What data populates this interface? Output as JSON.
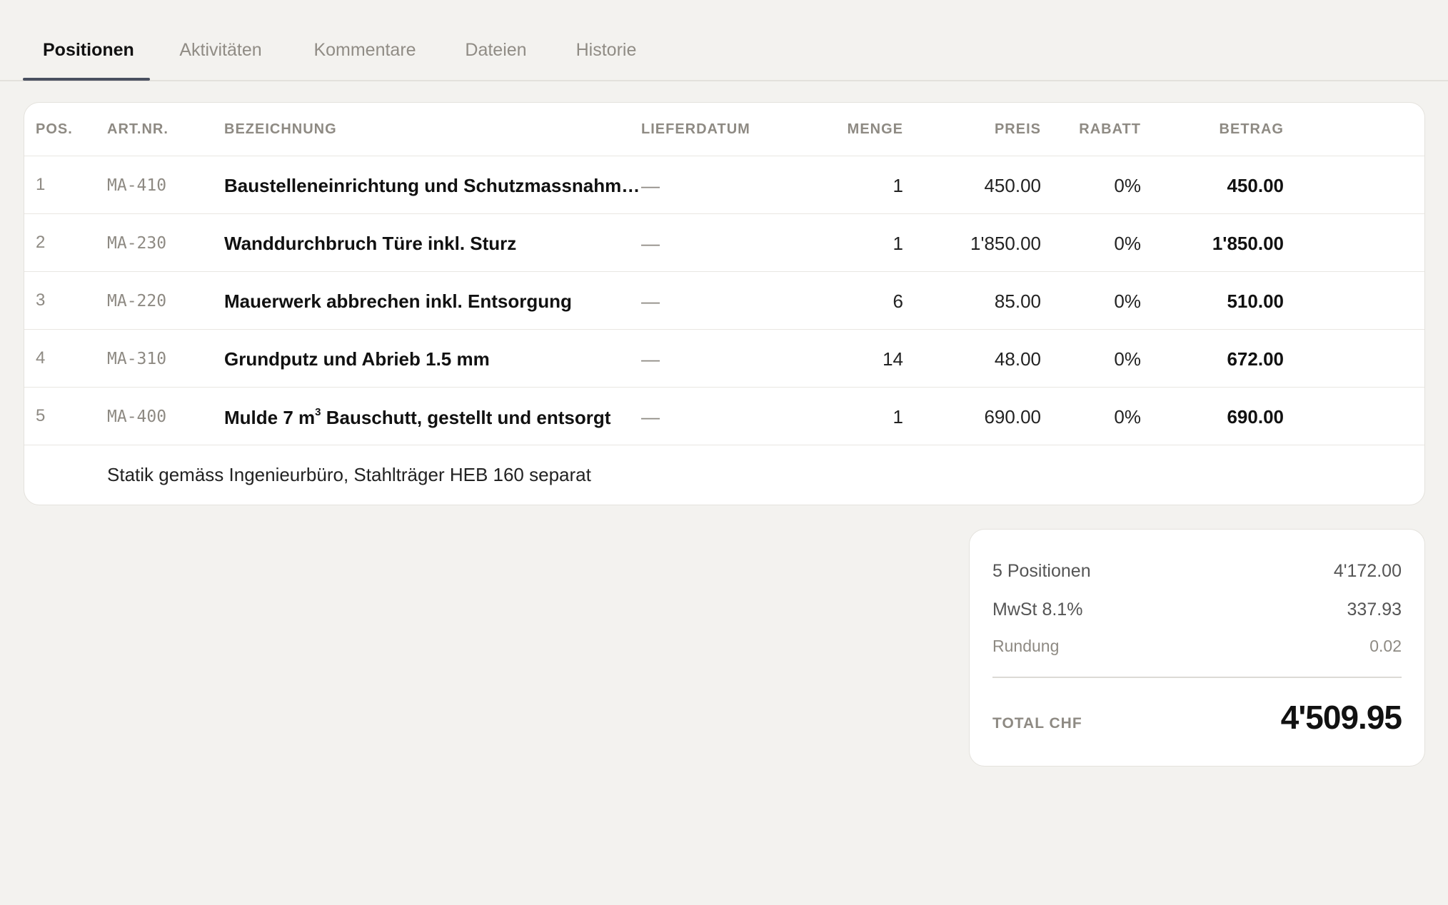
{
  "tabs": [
    {
      "label": "Positionen"
    },
    {
      "label": "Aktivitäten"
    },
    {
      "label": "Kommentare"
    },
    {
      "label": "Dateien"
    },
    {
      "label": "Historie"
    }
  ],
  "table": {
    "headers": {
      "pos": "POS.",
      "art": "ART.NR.",
      "bez": "BEZEICHNUNG",
      "lief": "LIEFERDATUM",
      "menge": "MENGE",
      "preis": "PREIS",
      "rabatt": "RABATT",
      "betrag": "BETRAG"
    },
    "rows": [
      {
        "pos": "1",
        "art": "MA-410",
        "bez": "Baustelleneinrichtung und Schutzmassnahm…",
        "lief": "—",
        "menge": "1",
        "preis": "450.00",
        "rabatt": "0%",
        "betrag": "450.00"
      },
      {
        "pos": "2",
        "art": "MA-230",
        "bez": "Wanddurchbruch Türe inkl. Sturz",
        "lief": "—",
        "menge": "1",
        "preis": "1'850.00",
        "rabatt": "0%",
        "betrag": "1'850.00"
      },
      {
        "pos": "3",
        "art": "MA-220",
        "bez": "Mauerwerk abbrechen inkl. Entsorgung",
        "lief": "—",
        "menge": "6",
        "preis": "85.00",
        "rabatt": "0%",
        "betrag": "510.00"
      },
      {
        "pos": "4",
        "art": "MA-310",
        "bez": "Grundputz und Abrieb 1.5 mm",
        "lief": "—",
        "menge": "14",
        "preis": "48.00",
        "rabatt": "0%",
        "betrag": "672.00"
      },
      {
        "pos": "5",
        "art": "MA-400",
        "bez_pre": "Mulde 7 m",
        "bez_sup": "3",
        "bez_post": " Bauschutt, gestellt und entsorgt",
        "lief": "—",
        "menge": "1",
        "preis": "690.00",
        "rabatt": "0%",
        "betrag": "690.00"
      }
    ],
    "note": "Statik gemäss Ingenieurbüro, Stahlträger HEB 160 separat"
  },
  "totals": {
    "positions_label": "5 Positionen",
    "positions_value": "4'172.00",
    "vat_label": "MwSt 8.1%",
    "vat_value": "337.93",
    "rounding_label": "Rundung",
    "rounding_value": "0.02",
    "total_label": "TOTAL CHF",
    "total_value": "4'509.95"
  }
}
